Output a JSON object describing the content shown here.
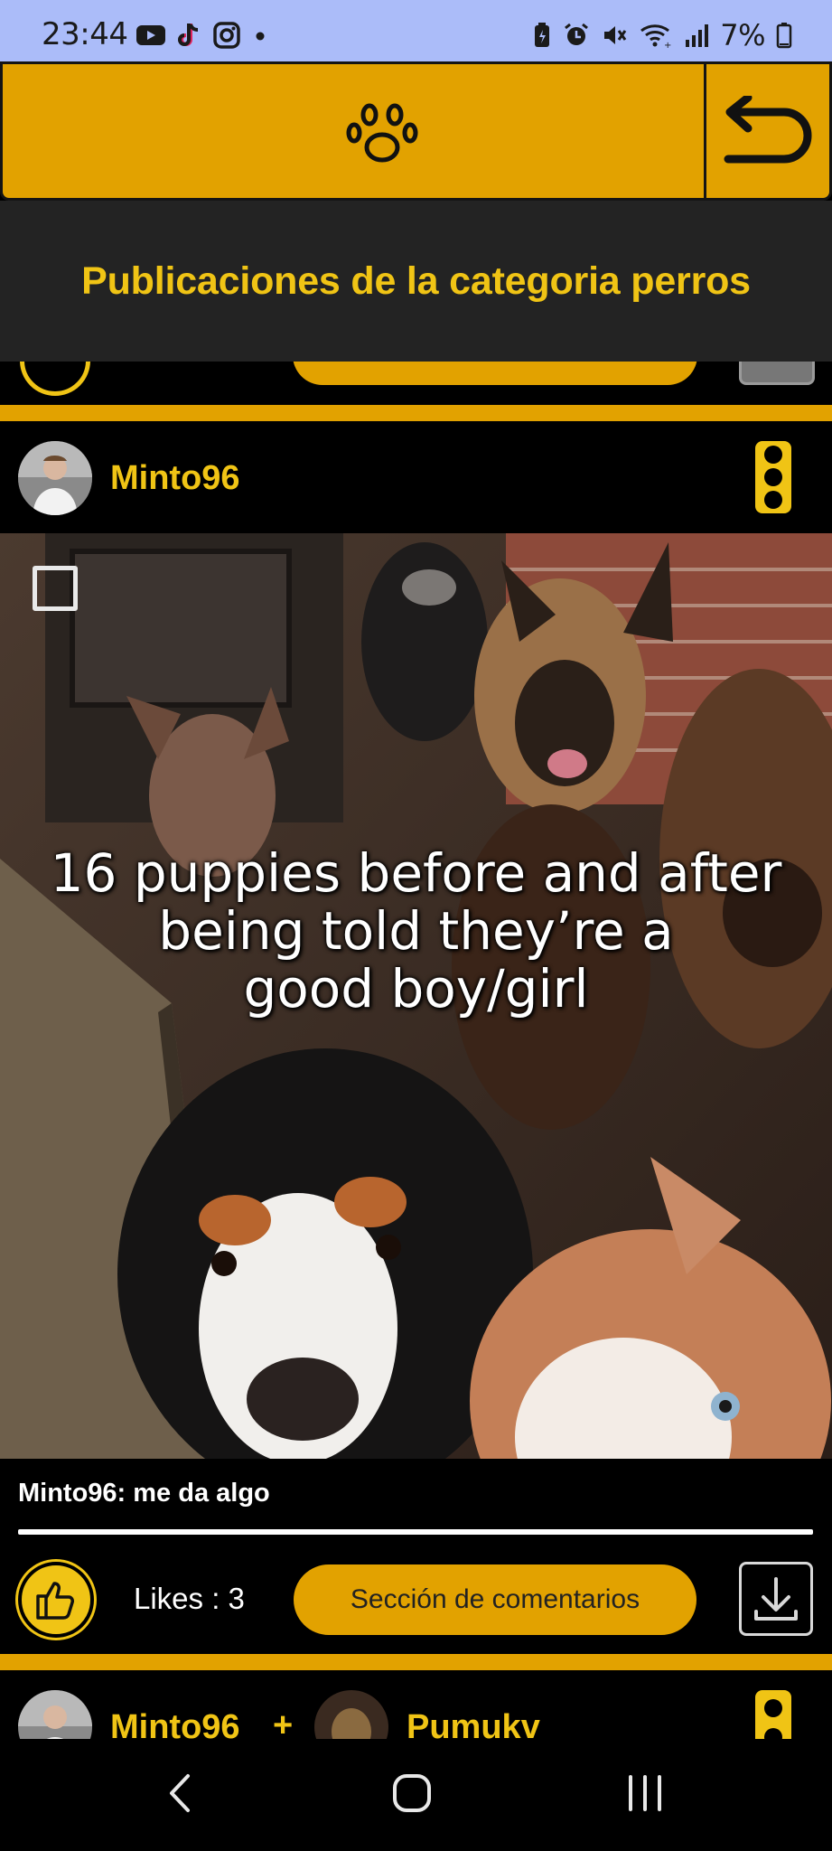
{
  "status_bar": {
    "time": "23:44",
    "battery": "7%",
    "left_icons": [
      "youtube-icon",
      "tiktok-icon",
      "instagram-icon",
      "dot-icon"
    ],
    "right_icons": [
      "battery-saver-icon",
      "alarm-icon",
      "mute-icon",
      "wifi-icon",
      "signal-icon",
      "battery-icon"
    ]
  },
  "header": {
    "logo_icon": "paw-icon",
    "back_icon": "undo-arrow-icon"
  },
  "page": {
    "title": "Publicaciones de la categoria perros"
  },
  "post": {
    "username": "Minto96",
    "media_caption_lines": [
      "16 puppies before and after",
      "being told they’re a",
      "good boy/girl"
    ],
    "comment": "Minto96: me da algo",
    "likes_label": "Likes : 3",
    "comments_button": "Sección de comentarios"
  },
  "next_post": {
    "user1": "Minto96",
    "plus": "+",
    "user2": "Pumukv"
  },
  "colors": {
    "accent": "#e2a200",
    "accent_text": "#f0c415",
    "status_bar": "#abbcf9",
    "title_band": "#232323"
  }
}
